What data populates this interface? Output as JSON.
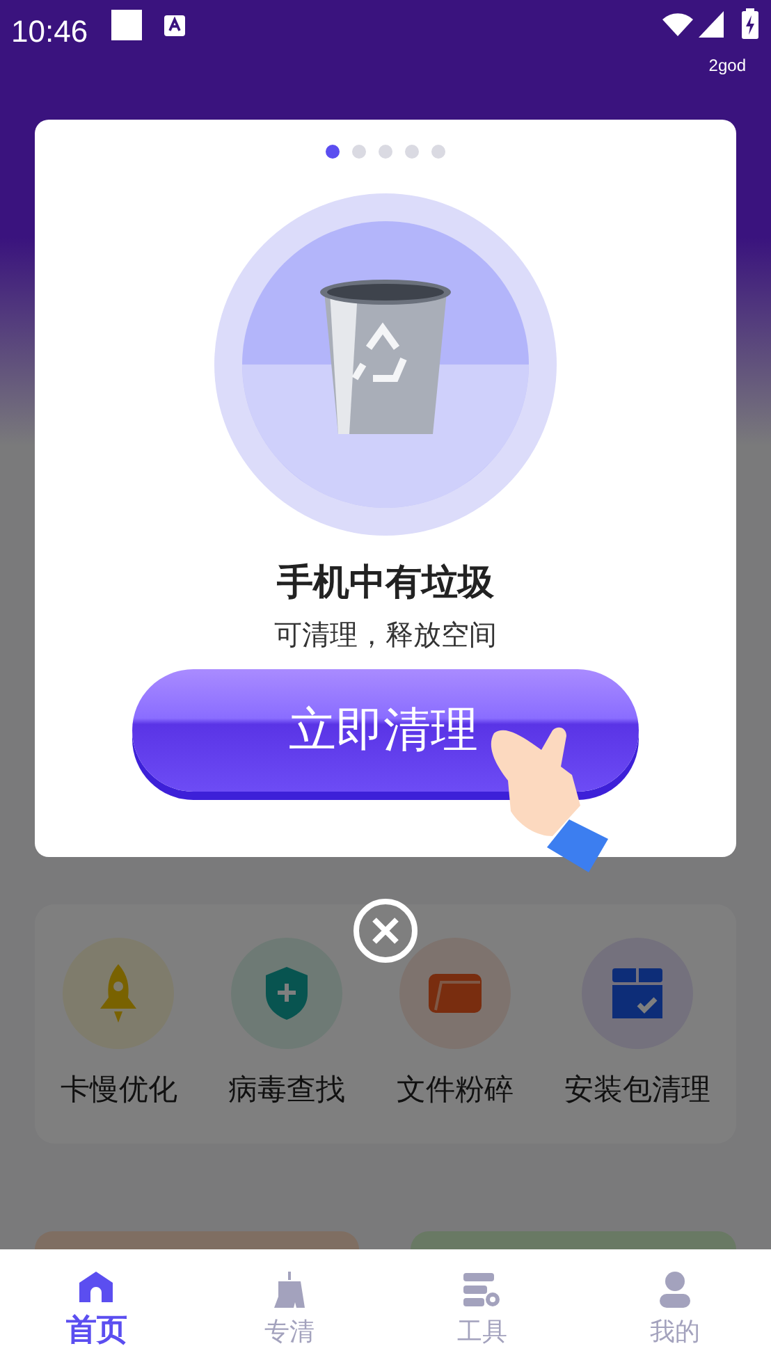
{
  "status_bar": {
    "time": "10:46",
    "carrier": "2god"
  },
  "dialog": {
    "pager": [
      {
        "selected": true
      },
      {
        "selected": false
      },
      {
        "selected": false
      },
      {
        "selected": false
      },
      {
        "selected": false
      }
    ],
    "title": "手机中有垃圾",
    "subtitle": "可清理，释放空间",
    "action": "立即清理"
  },
  "tools": [
    {
      "kind": "rocket",
      "label": "卡慢优化"
    },
    {
      "kind": "shield",
      "label": "病毒查找"
    },
    {
      "kind": "folder",
      "label": "文件粉碎"
    },
    {
      "kind": "package",
      "label": "安装包清理"
    }
  ],
  "nav": [
    {
      "kind": "home",
      "label": "首页",
      "selected": true
    },
    {
      "kind": "broom",
      "label": "专清",
      "selected": false
    },
    {
      "kind": "tools",
      "label": "工具",
      "selected": false
    },
    {
      "kind": "person",
      "label": "我的",
      "selected": false
    }
  ]
}
